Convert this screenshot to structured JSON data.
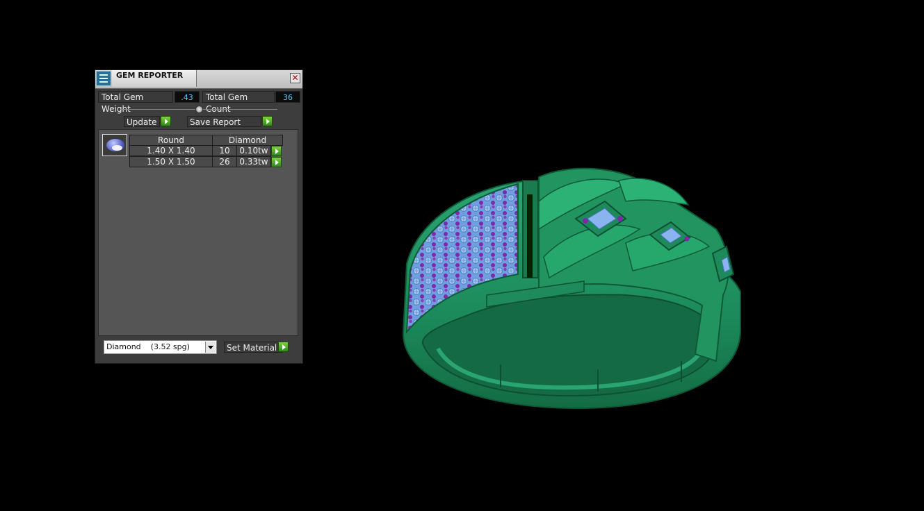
{
  "panel": {
    "title": "GEM REPORTER",
    "close_glyph": "✕",
    "total_weight_label": "Total Gem Weight",
    "total_weight_value": ".43",
    "total_count_label": "Total Gem Count",
    "total_count_value": "36",
    "update_label": "Update",
    "save_label": "Save Report",
    "table": {
      "headers": [
        "Round",
        "Diamond"
      ],
      "rows": [
        {
          "size": "1.40 X 1.40",
          "count": "10",
          "weight": "0.10tw"
        },
        {
          "size": "1.50 X 1.50",
          "count": "26",
          "weight": "0.33tw"
        }
      ]
    },
    "material_selected": "Diamond    (3.52 spg)",
    "set_material_label": "Set Material"
  },
  "colors": {
    "ring_green": "#1f8a5c",
    "gem_blue": "#8ab4f0",
    "gem_purple": "#7a2aa8",
    "value_blue": "#5cc8ff",
    "button_green": "#4caf22"
  }
}
